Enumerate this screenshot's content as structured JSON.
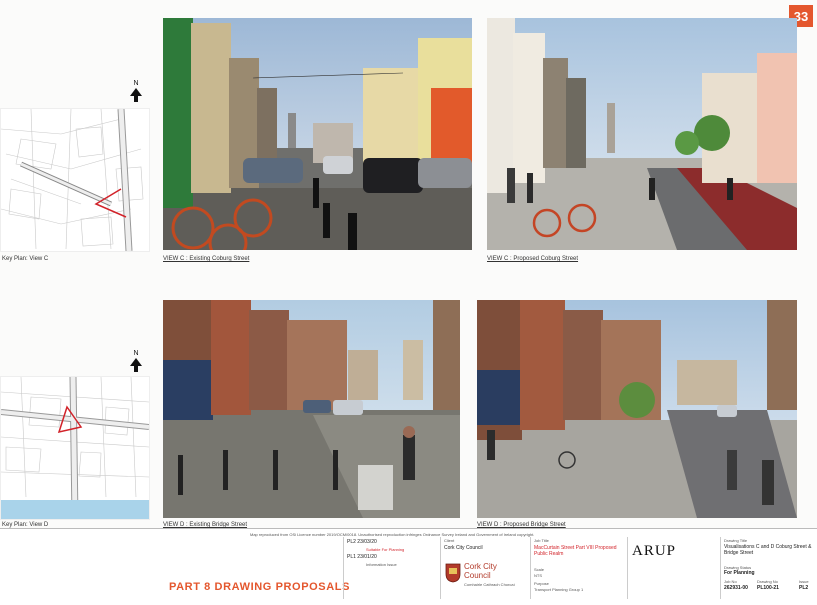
{
  "page": {
    "number": "33"
  },
  "views": {
    "c_existing": "VIEW C : Existing Coburg Street",
    "c_proposed": "VIEW C : Proposed Coburg Street",
    "d_existing": "VIEW D : Existing Bridge Street",
    "d_proposed": "VIEW D : Proposed Bridge Street"
  },
  "keyplans": {
    "c": "Key Plan: View C",
    "d": "Key Plan: View D",
    "north": "N"
  },
  "titleblock": {
    "heading": "PART 8 DRAWING PROPOSALS",
    "rev_rows": [
      {
        "rev": "PL2",
        "date": "23/03/20",
        "desc": "Suitable For Planning"
      },
      {
        "rev": "PL1",
        "date": "23/01/20",
        "desc": "Information Issue"
      }
    ],
    "client_label": "Client",
    "client": "Cork City Council",
    "council_name": "Cork City Council",
    "council_irish": "Comhairle Cathrach Chorcaí",
    "job_title_label": "Job Title",
    "job_title": "MacCurtain Street Part VIII Proposed Public Realm",
    "scale_label": "Scale",
    "scale": "NTS",
    "purpose_label": "Purpose",
    "purpose": "Transport Planning Group 1",
    "firm": "ARUP",
    "drawing_title_label": "Drawing Title",
    "drawing_title": "Visualisations C and D Coburg Street & Bridge Street",
    "status_label": "Drawing Status",
    "status": "For Planning",
    "job_no_label": "Job No",
    "job_no": "262931-00",
    "drawing_no_label": "Drawing No",
    "drawing_no": "PL100-21",
    "issue_label": "Issue",
    "issue": "PL2",
    "copyright_note": "Map reproduced from OSi Licence number 2019/OCM/0018. Unauthorised reproduction infringes Ordnance Survey Ireland and Government of Ireland copyright."
  }
}
